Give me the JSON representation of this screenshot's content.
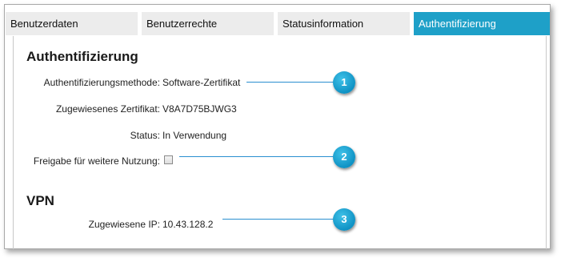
{
  "tabs": [
    {
      "label": "Benutzerdaten",
      "active": false
    },
    {
      "label": "Benutzerrechte",
      "active": false
    },
    {
      "label": "Statusinformation",
      "active": false
    },
    {
      "label": "Authentifizierung",
      "active": true
    }
  ],
  "auth": {
    "heading": "Authentifizierung",
    "method_label": "Authentifizierungsmethode:",
    "method_value": "Software-Zertifikat",
    "cert_label": "Zugewiesenes Zertifikat:",
    "cert_value": "V8A7D75BJWG3",
    "status_label": "Status:",
    "status_value": "In Verwendung",
    "release_label": "Freigabe für weitere Nutzung:",
    "release_checked": false
  },
  "vpn": {
    "heading": "VPN",
    "ip_label": "Zugewiesene IP:",
    "ip_value": "10.43.128.2"
  },
  "markers": [
    "1",
    "2",
    "3"
  ],
  "colors": {
    "accent": "#1ea0c8",
    "marker": "#1398c8",
    "leader": "#2a8fd0",
    "tab_inactive": "#ececec"
  }
}
